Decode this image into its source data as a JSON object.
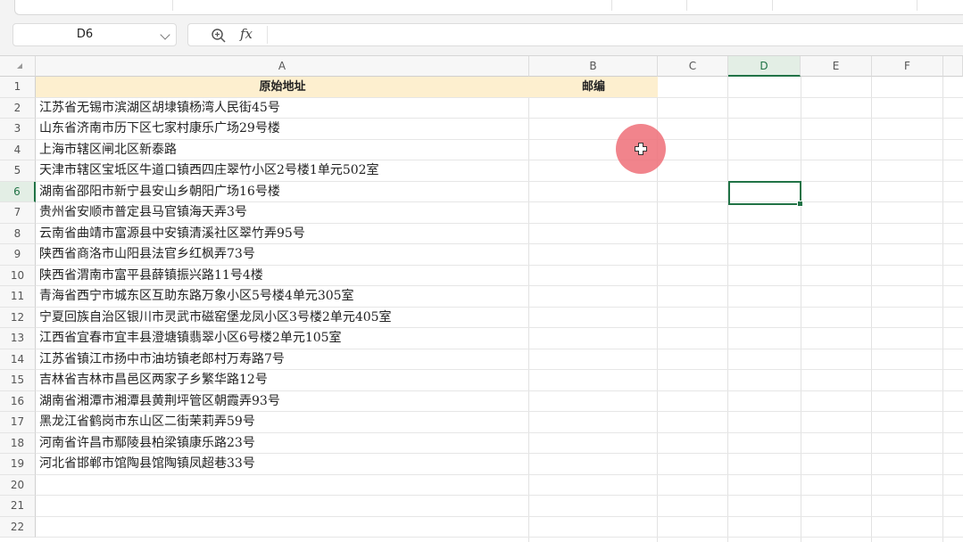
{
  "formula_bar": {
    "name_box": "D6",
    "fx_label": "fx",
    "content": ""
  },
  "columns": [
    "A",
    "B",
    "C",
    "D",
    "E",
    "F"
  ],
  "rows": [
    "1",
    "2",
    "3",
    "4",
    "5",
    "6",
    "7",
    "8",
    "9",
    "10",
    "11",
    "12",
    "13",
    "14",
    "15",
    "16",
    "17",
    "18",
    "19",
    "20",
    "21",
    "22"
  ],
  "header": {
    "a1": "原始地址",
    "b1": "邮编"
  },
  "addresses": [
    "江苏省无锡市滨湖区胡埭镇杨湾人民街45号",
    "山东省济南市历下区七家村康乐广场29号楼",
    "上海市辖区闸北区新泰路",
    "天津市辖区宝坻区牛道口镇西四庄翠竹小区2号楼1单元502室",
    "湖南省邵阳市新宁县安山乡朝阳广场16号楼",
    "贵州省安顺市普定县马官镇海天弄3号",
    "云南省曲靖市富源县中安镇清溪社区翠竹弄95号",
    "陕西省商洛市山阳县法官乡红枫弄73号",
    "陕西省渭南市富平县薛镇振兴路11号4楼",
    "青海省西宁市城东区互助东路万象小区5号楼4单元305室",
    "宁夏回族自治区银川市灵武市磁窑堡龙凤小区3号楼2单元405室",
    "江西省宜春市宜丰县澄塘镇翡翠小区6号楼2单元105室",
    "江苏省镇江市扬中市油坊镇老郎村万寿路7号",
    "吉林省吉林市昌邑区两家子乡繁华路12号",
    "湖南省湘潭市湘潭县黄荆坪管区朝霞弄93号",
    "黑龙江省鹤岗市东山区二街茉莉弄59号",
    "河南省许昌市鄢陵县柏梁镇康乐路23号",
    "河北省邯郸市馆陶县馆陶镇凤超巷33号"
  ],
  "active_cell": {
    "column": "D",
    "row": "6"
  },
  "colors": {
    "accent": "#217346",
    "header_fill": "#fdefcf",
    "cursor": "#ef6f78"
  }
}
